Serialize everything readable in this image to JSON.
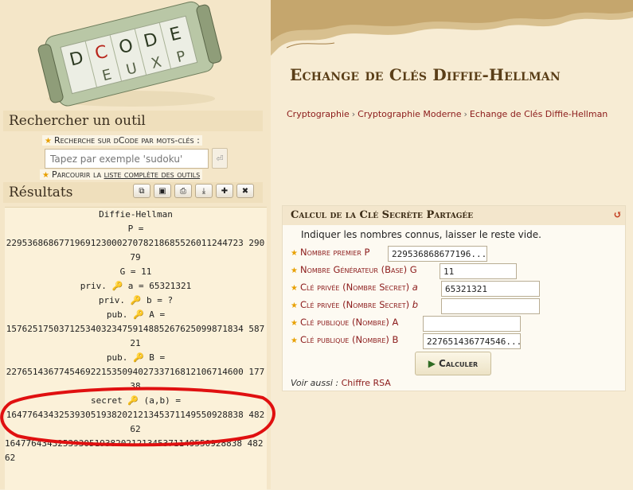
{
  "logo": {
    "letters_top": "DCODE",
    "letters_bottom": "EUXP"
  },
  "search": {
    "header": "Rechercher un outil",
    "keyword_link_prefix": "Recherche sur dCode par mots-clés :",
    "placeholder": "Tapez par exemple 'sudoku'",
    "go_label": "⏎",
    "browse_prefix": "Parcourir la",
    "browse_link": "liste complète des outils"
  },
  "results": {
    "header": "Résultats",
    "toolbar_icons": [
      "copy-icon",
      "save-icon",
      "print-icon",
      "download-icon",
      "pin-icon",
      "close-icon"
    ],
    "lines": {
      "title": "Diffie-Hellman",
      "p_label": "P =",
      "p_value": "229536868677196912300027078218685526011244723 29079",
      "g_line": "G = 11",
      "priv_a_pre": "priv.",
      "priv_a_post": "a = 65321321",
      "priv_b_pre": "priv.",
      "priv_b_post": "b = ?",
      "pub_a_pre": "pub.",
      "pub_a_post": "A =",
      "a_value": "157625175037125340323475914885267625099871834 58721",
      "pub_b_pre": "pub.",
      "pub_b_post": "B =",
      "b_value": "227651436774546922153509402733716812106714600 17738",
      "secret_pre": "secret",
      "secret_post": "(a,b) =",
      "secret_value": "164776434325393051938202121345371149550928838 48262",
      "raw_value": "164776434325393051938202121345371149550928838 48262"
    }
  },
  "page": {
    "title": "Echange de Clés Diffie-Hellman",
    "breadcrumb": [
      "Cryptographie",
      "Cryptographie Moderne",
      "Echange de Clés Diffie-Hellman"
    ]
  },
  "calc": {
    "title": "Calcul de la Clé Secrète Partagée",
    "hint": "Indiquer les nombres connus, laisser le reste vide.",
    "fields": {
      "p_label": "Nombre premier P",
      "p_value": "229536868677196...",
      "g_label": "Nombre Générateur (Base) G",
      "g_value": "11",
      "a_label": "Clé privée (Nombre Secret)",
      "a_var": "a",
      "a_value": "65321321",
      "b_label": "Clé privée (Nombre Secret)",
      "b_var": "b",
      "b_value": "",
      "pa_label": "Clé publique (Nombre) A",
      "pa_value": "",
      "pb_label": "Clé publique (Nombre) B",
      "pb_value": "227651436774546..."
    },
    "button": "Calculer",
    "see_also_label": "Voir aussi :",
    "see_also_link": "Chiffre RSA"
  },
  "colors": {
    "accent_red": "#8b1a1a",
    "star": "#e8a000",
    "annotation_circle": "#e01010"
  }
}
